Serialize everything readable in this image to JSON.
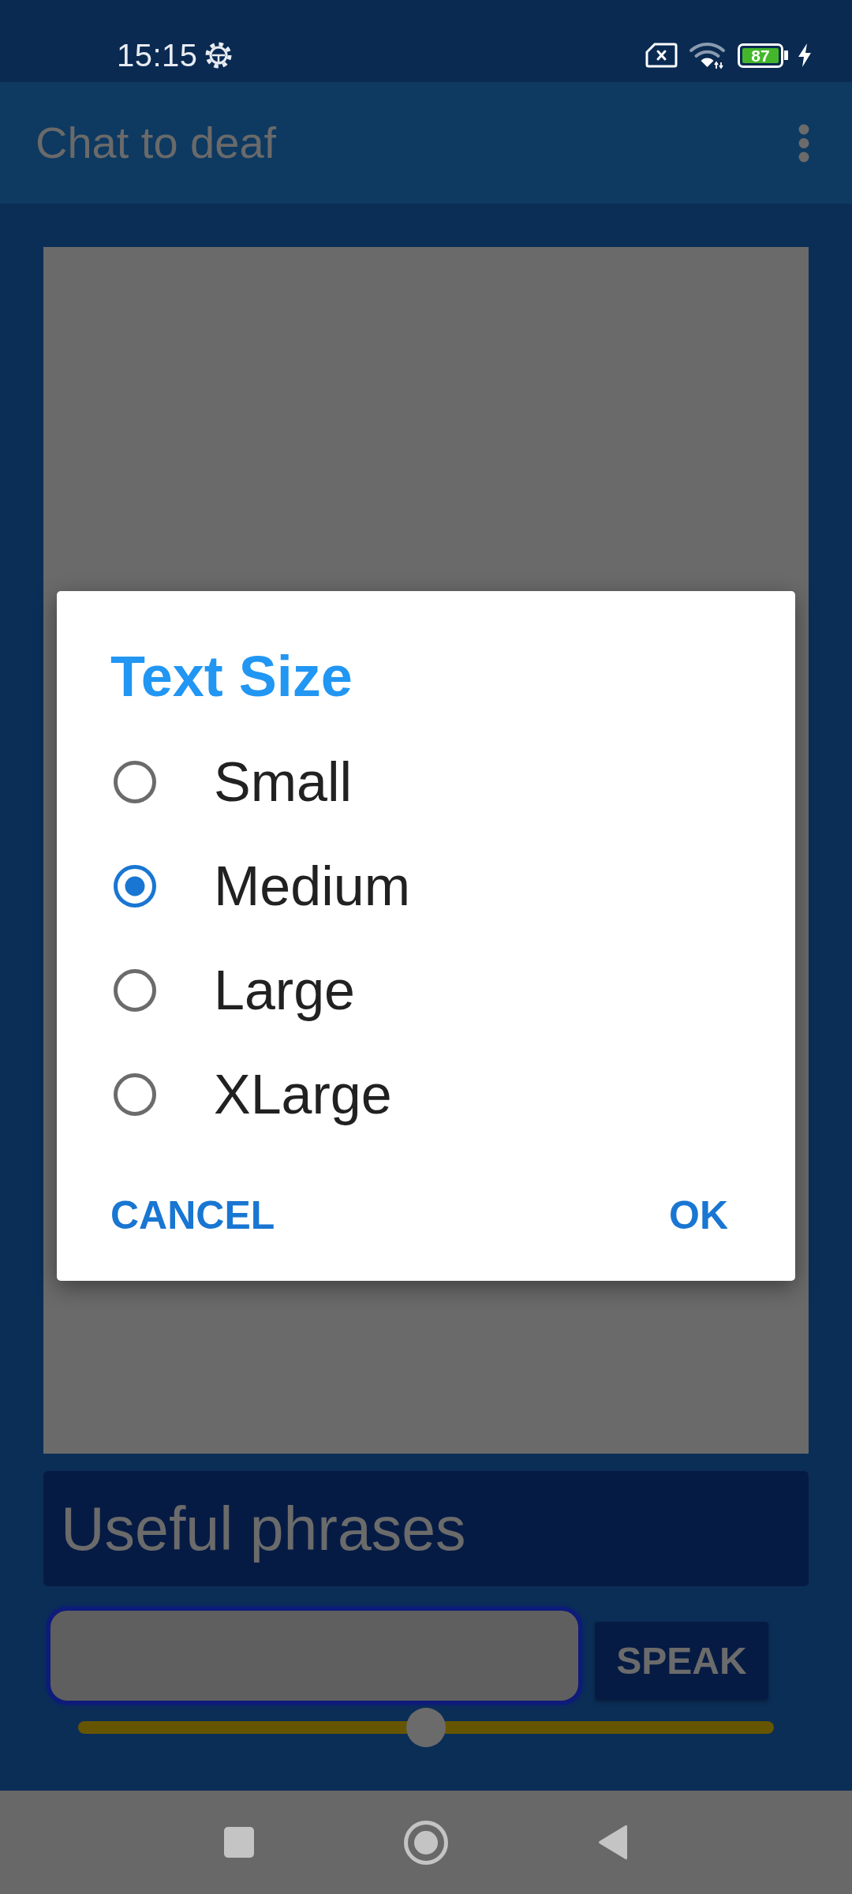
{
  "status_bar": {
    "time": "15:15",
    "battery": "87"
  },
  "app_bar": {
    "title": "Chat to deaf"
  },
  "dialog": {
    "title": "Text Size",
    "options": [
      {
        "label": "Small",
        "selected": false
      },
      {
        "label": "Medium",
        "selected": true
      },
      {
        "label": "Large",
        "selected": false
      },
      {
        "label": "XLarge",
        "selected": false
      }
    ],
    "buttons": [
      "CANCEL",
      "OK"
    ]
  },
  "phrases_button": {
    "label": "Useful phrases"
  },
  "speak_button": {
    "label": "SPEAK"
  },
  "slider": {
    "level": 0.5
  }
}
